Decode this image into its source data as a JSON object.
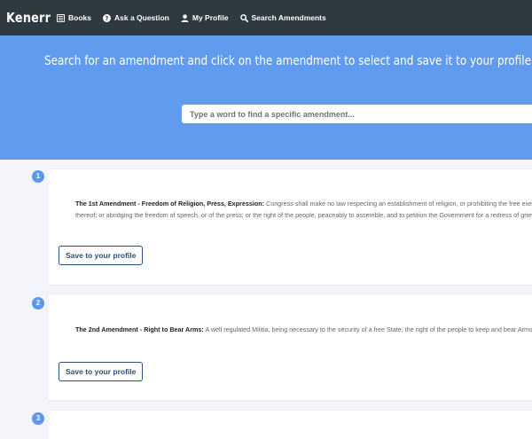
{
  "nav": {
    "brand": "Kenerr",
    "items": [
      {
        "label": "Books",
        "icon": "book-icon"
      },
      {
        "label": "Ask a Question",
        "icon": "question-circle-icon"
      },
      {
        "label": "My Profile",
        "icon": "user-icon"
      },
      {
        "label": "Search Amendments",
        "icon": "search-icon"
      }
    ]
  },
  "hero": {
    "title": "Search for an amendment and click on the amendment to select and save it to your profile.",
    "search_placeholder": "Type a word to find a specific amendment..."
  },
  "amendments": [
    {
      "number": "1",
      "title": "The 1st Amendment - Freedom of Religion, Press, Expression:",
      "text": "Congress shall make no law respecting an establishment of religion, or prohibiting the free exercise thereof; or abridging the freedom of speech, or of the press; or the right of the people, peaceably to assemble, and to petition the Government for a redress of grievances.",
      "button": "Save to your profile"
    },
    {
      "number": "2",
      "title": "The 2nd Amendment - Right to Bear Arms:",
      "text": "A well regulated Militia, being necessary to the security of a free State, the right of the people to keep and bear Arms, shall not be infringed.",
      "button": "Save to your profile"
    },
    {
      "number": "3",
      "title": "",
      "text": "",
      "button": ""
    }
  ],
  "colors": {
    "navbar": "#2e3a40",
    "hero": "#609bf0",
    "badge": "#5c97ee",
    "button_border": "#2d4f7c",
    "page_bg": "#f4f5fb"
  }
}
